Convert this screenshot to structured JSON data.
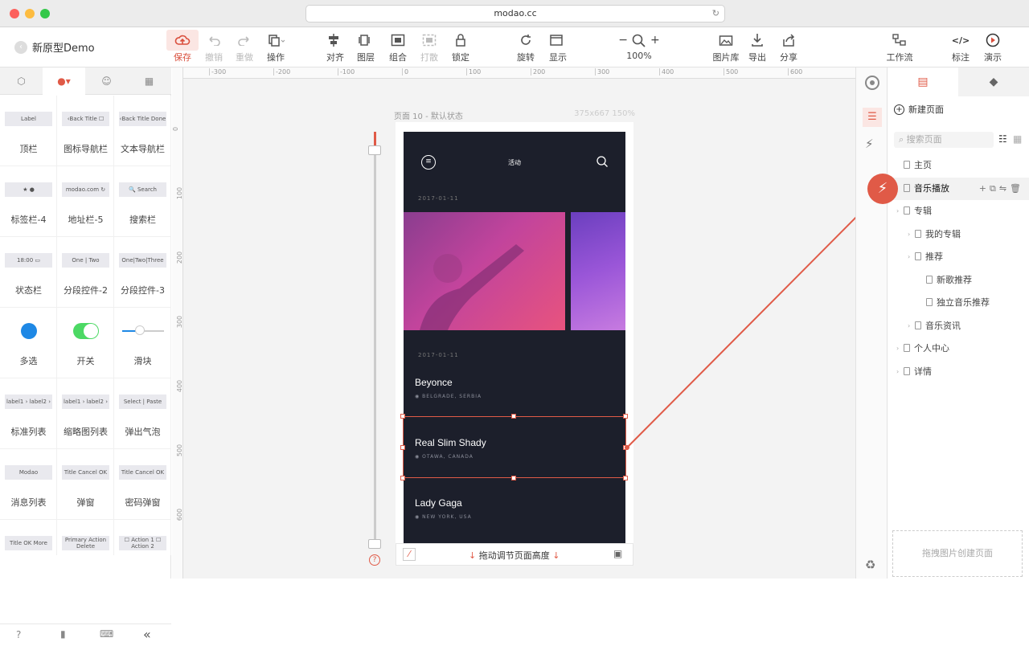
{
  "browser": {
    "url": "modao.cc"
  },
  "project": {
    "name": "新原型Demo"
  },
  "toolbar": {
    "save": "保存",
    "undo": "撤销",
    "redo": "重做",
    "ops": "操作",
    "align": "对齐",
    "layer": "图层",
    "group": "组合",
    "ungroup": "打散",
    "lock": "锁定",
    "rotate": "旋转",
    "display": "显示",
    "zoom": "100%",
    "gallery": "图片库",
    "export": "导出",
    "share": "分享",
    "workflow": "工作流",
    "annotate": "标注",
    "preview": "演示"
  },
  "components": [
    {
      "label": "顶栏",
      "thumb": "Label"
    },
    {
      "label": "图标导航栏",
      "thumb": "‹Back  Title  ☐"
    },
    {
      "label": "文本导航栏",
      "thumb": "‹Back  Title  Done"
    },
    {
      "label": "标签栏-4",
      "thumb": "★  ●"
    },
    {
      "label": "地址栏-5",
      "thumb": "modao.com ↻"
    },
    {
      "label": "搜索栏",
      "thumb": "🔍 Search"
    },
    {
      "label": "状态栏",
      "thumb": "18:00 ▭"
    },
    {
      "label": "分段控件-2",
      "thumb": "One | Two"
    },
    {
      "label": "分段控件-3",
      "thumb": "One|Two|Three"
    },
    {
      "label": "多选",
      "thumb": ""
    },
    {
      "label": "开关",
      "thumb": ""
    },
    {
      "label": "滑块",
      "thumb": ""
    },
    {
      "label": "标准列表",
      "thumb": "label1 ›  label2 ›"
    },
    {
      "label": "缩略图列表",
      "thumb": "label1 ›  label2 ›"
    },
    {
      "label": "弹出气泡",
      "thumb": "Select | Paste"
    },
    {
      "label": "消息列表",
      "thumb": "Modao"
    },
    {
      "label": "弹窗",
      "thumb": "Title  Cancel OK"
    },
    {
      "label": "密码弹窗",
      "thumb": "Title  Cancel OK"
    },
    {
      "label": "",
      "thumb": "Title OK More"
    },
    {
      "label": "",
      "thumb": "Primary Action  Delete"
    },
    {
      "label": "",
      "thumb": "☐ Action 1  ☐ Action 2"
    }
  ],
  "ruler": {
    "h": [
      "-300",
      "-200",
      "-100",
      "0",
      "100",
      "200",
      "300",
      "400",
      "500",
      "600"
    ],
    "v": [
      "0",
      "100",
      "200",
      "300",
      "400",
      "500",
      "600"
    ]
  },
  "artboard": {
    "title": "页面 10 - 默认状态",
    "size": "375x667 150%",
    "drag_hint": "拖动调节页面高度"
  },
  "app": {
    "header": "活动",
    "date1": "2017-01-11",
    "date2": "2017-01-11",
    "items": [
      {
        "title": "Beyonce",
        "loc": "BELGRADE, SERBIA"
      },
      {
        "title": "Real Slim Shady",
        "loc": "OTAWA, CANADA"
      },
      {
        "title": "Lady Gaga",
        "loc": "NEW YORK, USA"
      }
    ]
  },
  "pages": {
    "new_page": "新建页面",
    "search_placeholder": "搜索页面",
    "list": [
      {
        "name": "主页",
        "indent": 0
      },
      {
        "name": "音乐播放",
        "indent": 0
      },
      {
        "name": "专辑",
        "indent": 0
      },
      {
        "name": "我的专辑",
        "indent": 1
      },
      {
        "name": "推荐",
        "indent": 1
      },
      {
        "name": "新歌推荐",
        "indent": 2
      },
      {
        "name": "独立音乐推荐",
        "indent": 2
      },
      {
        "name": "音乐资讯",
        "indent": 1
      },
      {
        "name": "个人中心",
        "indent": 0
      },
      {
        "name": "详情",
        "indent": 0
      }
    ],
    "drop_hint": "拖拽图片创建页面"
  },
  "colors": {
    "accent": "#e05a47",
    "selected_bg": "#f2f2f2",
    "phone_bg": "#1c1f2b"
  }
}
